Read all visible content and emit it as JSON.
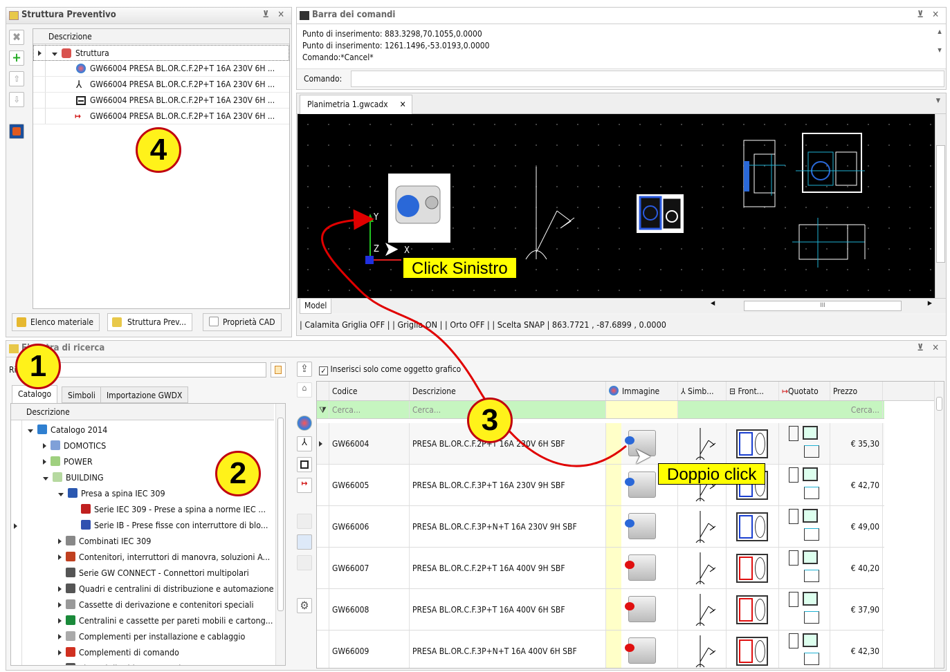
{
  "structure_panel": {
    "title": "Struttura Preventivo",
    "column": "Descrizione",
    "root": "Struttura",
    "rows": [
      "GW66004 PRESA BL.OR.C.F.2P+T 16A 230V 6H ...",
      "GW66004 PRESA BL.OR.C.F.2P+T 16A 230V 6H ...",
      "GW66004 PRESA BL.OR.C.F.2P+T 16A 230V 6H ...",
      "GW66004 PRESA BL.OR.C.F.2P+T 16A 230V 6H ..."
    ],
    "tabs": [
      "Elenco materiale",
      "Struttura Prev...",
      "Proprietà CAD"
    ]
  },
  "command_panel": {
    "title": "Barra dei comandi",
    "lines": [
      "Punto di inserimento: 883.3298,70.1055,0.0000",
      "Punto di inserimento: 1261.1496,-53.0193,0.0000",
      "Comando:*Cancel*"
    ],
    "prompt_label": "Comando:"
  },
  "cad": {
    "tab": "Planimetria 1.gwcadx",
    "model_tab": "Model",
    "status": "| Calamita Griglia OFF | | Griglia ON | | Orto OFF | | Scelta SNAP | 863.7721 , -87.6899 , 0.0000",
    "axis_y": "Y",
    "axis_x": "X",
    "axis_z": "Z"
  },
  "search_panel": {
    "title": "Finestra di ricerca",
    "search_label": "Ri",
    "tabs": [
      "Catalogo",
      "Simboli",
      "Importazione GWDX"
    ],
    "tree_header": "Descrizione",
    "tree": [
      {
        "label": "Catalogo 2014",
        "level": 0,
        "exp": "open",
        "ic": "#2f7fd0"
      },
      {
        "label": "DOMOTICS",
        "level": 1,
        "exp": "closed",
        "ic": "#7fa0d8"
      },
      {
        "label": "POWER",
        "level": 1,
        "exp": "closed",
        "ic": "#9fd07f"
      },
      {
        "label": "BUILDING",
        "level": 1,
        "exp": "open",
        "ic": "#b6d9a0"
      },
      {
        "label": "Presa a spina IEC 309",
        "level": 2,
        "exp": "open",
        "ic": "#2b58b0"
      },
      {
        "label": "Serie IEC 309 - Prese a spina a norme IEC ...",
        "level": 3,
        "exp": "",
        "ic": "#c02020"
      },
      {
        "label": "Serie IB - Prese fisse con interruttore di blo...",
        "level": 3,
        "exp": "",
        "ic": "#3050b0"
      },
      {
        "label": "Combinati IEC 309",
        "level": 2,
        "exp": "closed",
        "ic": "#888"
      },
      {
        "label": "Contenitori, interruttori di manovra, soluzioni A...",
        "level": 2,
        "exp": "closed",
        "ic": "#c04020"
      },
      {
        "label": "Serie GW CONNECT - Connettori multipolari",
        "level": 2,
        "exp": "",
        "ic": "#555"
      },
      {
        "label": "Quadri e centralini di distribuzione e automazione",
        "level": 2,
        "exp": "closed",
        "ic": "#555"
      },
      {
        "label": "Cassette di derivazione e contenitori speciali",
        "level": 2,
        "exp": "closed",
        "ic": "#999"
      },
      {
        "label": "Centralini e cassette per pareti mobili e cartong...",
        "level": 2,
        "exp": "closed",
        "ic": "#1a8a3a"
      },
      {
        "label": "Complementi per installazione e cablaggio",
        "level": 2,
        "exp": "closed",
        "ic": "#aaa"
      },
      {
        "label": "Complementi di comando",
        "level": 2,
        "exp": "closed",
        "ic": "#d03020"
      },
      {
        "label": "Sistemi di tubi e accessori",
        "level": 2,
        "exp": "closed",
        "ic": "#555"
      }
    ],
    "insert_graphic": "Inserisci solo come oggetto grafico",
    "columns": [
      "Codice",
      "Descrizione",
      "Immagine",
      "Simb...",
      "Front...",
      "Quotato",
      "Prezzo"
    ],
    "filter": [
      "Cerca...",
      "Cerca...",
      "Cerca..."
    ],
    "rows": [
      {
        "code": "GW66004",
        "desc": "PRESA BL.OR.C.F.2P+T 16A 230V 6H SBF",
        "price": "€ 35,30",
        "color": "#1a3fd0"
      },
      {
        "code": "GW66005",
        "desc": "PRESA BL.OR.C.F.3P+T 16A 230V 9H SBF",
        "price": "€ 42,70",
        "color": "#1a3fd0"
      },
      {
        "code": "GW66006",
        "desc": "PRESA BL.OR.C.F.3P+N+T 16A 230V 9H SBF",
        "price": "€ 49,00",
        "color": "#1a3fd0"
      },
      {
        "code": "GW66007",
        "desc": "PRESA BL.OR.C.F.2P+T 16A 400V 9H SBF",
        "price": "€ 40,20",
        "color": "#e01010"
      },
      {
        "code": "GW66008",
        "desc": "PRESA BL.OR.C.F.3P+T 16A 400V 6H SBF",
        "price": "€ 37,90",
        "color": "#e01010"
      },
      {
        "code": "GW66009",
        "desc": "PRESA BL.OR.C.F.3P+N+T 16A 400V 6H SBF",
        "price": "€ 42,30",
        "color": "#e01010"
      }
    ]
  },
  "annotations": {
    "b1": "1",
    "b2": "2",
    "b3": "3",
    "b4": "4",
    "click_left": "Click Sinistro",
    "double_click": "Doppio click"
  },
  "colors": {
    "arrow": "#e00000",
    "badge_fill": "#fff21a",
    "callout": "#ffff00"
  }
}
